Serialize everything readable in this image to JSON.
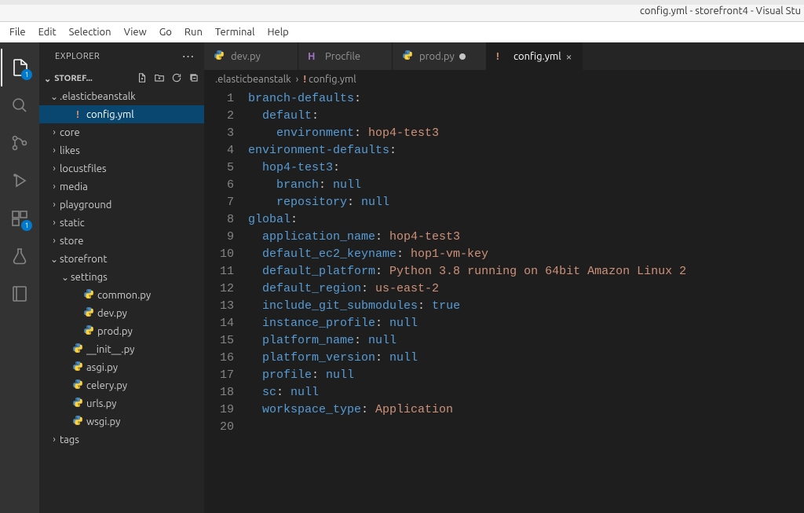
{
  "window": {
    "title": "config.yml - storefront4 - Visual Stu"
  },
  "menubar": [
    "File",
    "Edit",
    "Selection",
    "View",
    "Go",
    "Run",
    "Terminal",
    "Help"
  ],
  "activitybar": {
    "explorer_badge": "1",
    "extensions_badge": "1"
  },
  "sidebar": {
    "title": "EXPLORER",
    "project": "STOREF...",
    "tree": [
      {
        "depth": 0,
        "type": "folder",
        "open": true,
        "label": ".elasticbeanstalk"
      },
      {
        "depth": 1,
        "type": "file",
        "icon": "yml",
        "label": "config.yml",
        "selected": true
      },
      {
        "depth": 0,
        "type": "folder",
        "open": false,
        "label": "core"
      },
      {
        "depth": 0,
        "type": "folder",
        "open": false,
        "label": "likes"
      },
      {
        "depth": 0,
        "type": "folder",
        "open": false,
        "label": "locustfiles"
      },
      {
        "depth": 0,
        "type": "folder",
        "open": false,
        "label": "media"
      },
      {
        "depth": 0,
        "type": "folder",
        "open": false,
        "label": "playground"
      },
      {
        "depth": 0,
        "type": "folder",
        "open": false,
        "label": "static"
      },
      {
        "depth": 0,
        "type": "folder",
        "open": false,
        "label": "store"
      },
      {
        "depth": 0,
        "type": "folder",
        "open": true,
        "label": "storefront"
      },
      {
        "depth": 1,
        "type": "folder",
        "open": true,
        "label": "settings"
      },
      {
        "depth": 2,
        "type": "file",
        "icon": "py",
        "label": "common.py"
      },
      {
        "depth": 2,
        "type": "file",
        "icon": "py",
        "label": "dev.py"
      },
      {
        "depth": 2,
        "type": "file",
        "icon": "py",
        "label": "prod.py"
      },
      {
        "depth": 1,
        "type": "file",
        "icon": "py",
        "label": "__init__.py"
      },
      {
        "depth": 1,
        "type": "file",
        "icon": "py",
        "label": "asgi.py"
      },
      {
        "depth": 1,
        "type": "file",
        "icon": "py",
        "label": "celery.py"
      },
      {
        "depth": 1,
        "type": "file",
        "icon": "py",
        "label": "urls.py"
      },
      {
        "depth": 1,
        "type": "file",
        "icon": "py",
        "label": "wsgi.py"
      },
      {
        "depth": 0,
        "type": "folder",
        "open": false,
        "label": "tags"
      }
    ]
  },
  "tabs": [
    {
      "icon": "py",
      "label": "dev.py",
      "active": false,
      "dirty": false
    },
    {
      "icon": "procfile",
      "label": "Procfile",
      "active": false,
      "dirty": false
    },
    {
      "icon": "py",
      "label": "prod.py",
      "active": false,
      "dirty": true
    },
    {
      "icon": "yml",
      "label": "config.yml",
      "active": true,
      "dirty": false
    }
  ],
  "breadcrumbs": [
    {
      "icon": null,
      "text": ".elasticbeanstalk"
    },
    {
      "icon": "yml",
      "text": "config.yml"
    }
  ],
  "code": {
    "lines": [
      [
        {
          "t": "key",
          "v": "branch-defaults"
        },
        {
          "t": "p",
          "v": ":"
        }
      ],
      [
        {
          "t": "ind",
          "v": 1
        },
        {
          "t": "key",
          "v": "default"
        },
        {
          "t": "p",
          "v": ":"
        }
      ],
      [
        {
          "t": "ind",
          "v": 2
        },
        {
          "t": "key",
          "v": "environment"
        },
        {
          "t": "p",
          "v": ": "
        },
        {
          "t": "str",
          "v": "hop4-test3"
        }
      ],
      [
        {
          "t": "key",
          "v": "environment-defaults"
        },
        {
          "t": "p",
          "v": ":"
        }
      ],
      [
        {
          "t": "ind",
          "v": 1
        },
        {
          "t": "key",
          "v": "hop4-test3"
        },
        {
          "t": "p",
          "v": ":"
        }
      ],
      [
        {
          "t": "ind",
          "v": 2
        },
        {
          "t": "key",
          "v": "branch"
        },
        {
          "t": "p",
          "v": ": "
        },
        {
          "t": "bool",
          "v": "null"
        }
      ],
      [
        {
          "t": "ind",
          "v": 2
        },
        {
          "t": "key",
          "v": "repository"
        },
        {
          "t": "p",
          "v": ": "
        },
        {
          "t": "bool",
          "v": "null"
        }
      ],
      [
        {
          "t": "key",
          "v": "global"
        },
        {
          "t": "p",
          "v": ":"
        }
      ],
      [
        {
          "t": "ind",
          "v": 1
        },
        {
          "t": "key",
          "v": "application_name"
        },
        {
          "t": "p",
          "v": ": "
        },
        {
          "t": "str",
          "v": "hop4-test3"
        }
      ],
      [
        {
          "t": "ind",
          "v": 1
        },
        {
          "t": "key",
          "v": "default_ec2_keyname"
        },
        {
          "t": "p",
          "v": ": "
        },
        {
          "t": "str",
          "v": "hop1-vm-key"
        }
      ],
      [
        {
          "t": "ind",
          "v": 1
        },
        {
          "t": "key",
          "v": "default_platform"
        },
        {
          "t": "p",
          "v": ": "
        },
        {
          "t": "str",
          "v": "Python 3.8 running on 64bit Amazon Linux 2"
        }
      ],
      [
        {
          "t": "ind",
          "v": 1
        },
        {
          "t": "key",
          "v": "default_region"
        },
        {
          "t": "p",
          "v": ": "
        },
        {
          "t": "str",
          "v": "us-east-2"
        }
      ],
      [
        {
          "t": "ind",
          "v": 1
        },
        {
          "t": "key",
          "v": "include_git_submodules"
        },
        {
          "t": "p",
          "v": ": "
        },
        {
          "t": "bool",
          "v": "true"
        }
      ],
      [
        {
          "t": "ind",
          "v": 1
        },
        {
          "t": "key",
          "v": "instance_profile"
        },
        {
          "t": "p",
          "v": ": "
        },
        {
          "t": "bool",
          "v": "null"
        }
      ],
      [
        {
          "t": "ind",
          "v": 1
        },
        {
          "t": "key",
          "v": "platform_name"
        },
        {
          "t": "p",
          "v": ": "
        },
        {
          "t": "bool",
          "v": "null"
        }
      ],
      [
        {
          "t": "ind",
          "v": 1
        },
        {
          "t": "key",
          "v": "platform_version"
        },
        {
          "t": "p",
          "v": ": "
        },
        {
          "t": "bool",
          "v": "null"
        }
      ],
      [
        {
          "t": "ind",
          "v": 1
        },
        {
          "t": "key",
          "v": "profile"
        },
        {
          "t": "p",
          "v": ": "
        },
        {
          "t": "bool",
          "v": "null"
        }
      ],
      [
        {
          "t": "ind",
          "v": 1
        },
        {
          "t": "key",
          "v": "sc"
        },
        {
          "t": "p",
          "v": ": "
        },
        {
          "t": "bool",
          "v": "null"
        }
      ],
      [
        {
          "t": "ind",
          "v": 1
        },
        {
          "t": "key",
          "v": "workspace_type"
        },
        {
          "t": "p",
          "v": ": "
        },
        {
          "t": "str",
          "v": "Application"
        }
      ],
      []
    ]
  }
}
